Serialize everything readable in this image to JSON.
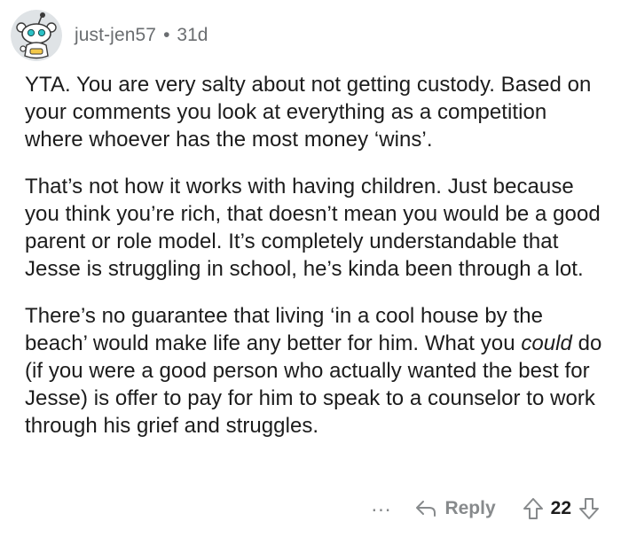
{
  "comment": {
    "author": "just-jen57",
    "separator": "•",
    "age": "31d",
    "paragraphs": [
      "YTA. You are very salty about not getting custody. Based on your comments you look at everything as a competition where whoever has the most money ‘wins’.",
      "That’s not how it works with having children. Just because you think you’re rich, that doesn’t mean you would be a good parent or role model. It’s completely understandable that Jesse is struggling in school, he’s kinda been through a lot.",
      {
        "before": "There’s no guarantee that living ‘in a cool house by the beach’ would make life any better for him. What you ",
        "italic": "could",
        "after": " do (if you were a good person who actually wanted the best for Jesse) is offer to pay for him to speak to a counselor to work through his grief and struggles."
      }
    ],
    "actions": {
      "more_label": "...",
      "reply_label": "Reply",
      "score": "22"
    }
  },
  "colors": {
    "text": "#1c1c1c",
    "meta": "#6a6d70",
    "action": "#878a8c",
    "avatar_bg": "#dfe3e6"
  },
  "icons": {
    "avatar": "snoo-avatar-icon",
    "reply": "reply-arrow-icon",
    "upvote": "upvote-arrow-icon",
    "downvote": "downvote-arrow-icon"
  }
}
